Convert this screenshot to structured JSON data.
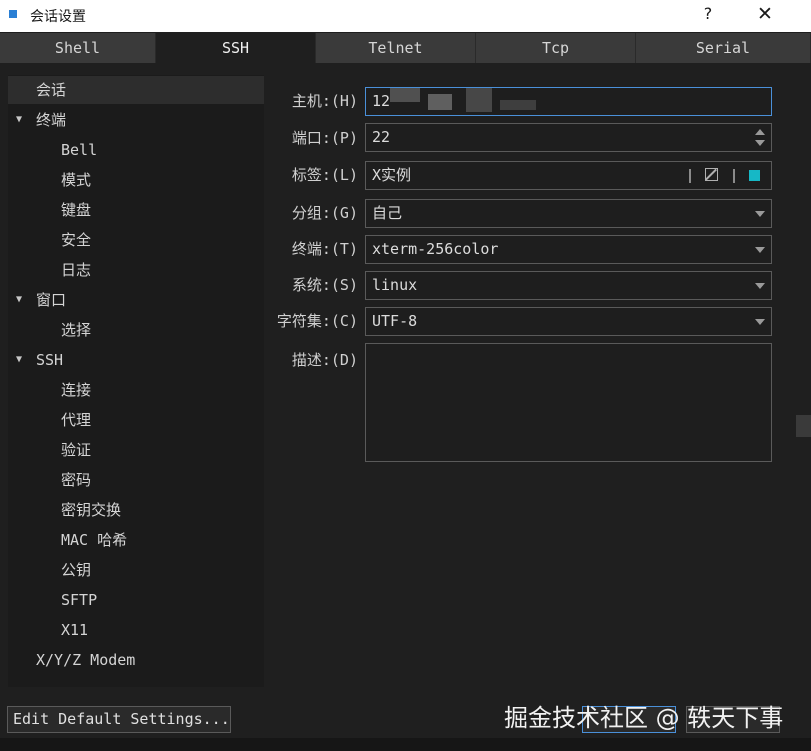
{
  "window": {
    "title": "会话设置",
    "help_label": "?",
    "close_label": "✕"
  },
  "tabs": [
    {
      "label": "Shell",
      "active": false
    },
    {
      "label": "SSH",
      "active": true
    },
    {
      "label": "Telnet",
      "active": false
    },
    {
      "label": "Tcp",
      "active": false
    },
    {
      "label": "Serial",
      "active": false
    }
  ],
  "tree": [
    {
      "label": "会话"
    },
    {
      "label": "终端"
    },
    {
      "label": "Bell"
    },
    {
      "label": "模式"
    },
    {
      "label": "键盘"
    },
    {
      "label": "安全"
    },
    {
      "label": "日志"
    },
    {
      "label": "窗口"
    },
    {
      "label": "选择"
    },
    {
      "label": "SSH"
    },
    {
      "label": "连接"
    },
    {
      "label": "代理"
    },
    {
      "label": "验证"
    },
    {
      "label": "密码"
    },
    {
      "label": "密钥交换"
    },
    {
      "label": "MAC 哈希"
    },
    {
      "label": "公钥"
    },
    {
      "label": "SFTP"
    },
    {
      "label": "X11"
    },
    {
      "label": "X/Y/Z Modem"
    }
  ],
  "form": {
    "host_label": "主机:(H)",
    "host_value": "12",
    "port_label": "端口:(P)",
    "port_value": "22",
    "tag_label": "标签:(L)",
    "tag_value": "X实例",
    "tag_color": "#16b8c6",
    "group_label": "分组:(G)",
    "group_value": "自己",
    "terminal_label": "终端:(T)",
    "terminal_value": "xterm-256color",
    "system_label": "系统:(S)",
    "system_value": "linux",
    "charset_label": "字符集:(C)",
    "charset_value": "UTF-8",
    "desc_label": "描述:(D)",
    "desc_value": ""
  },
  "footer": {
    "edit_default_label": "Edit Default Settings...",
    "watermark": "掘金技术社区 @ 轶天下事"
  },
  "icons": {
    "app": "app-icon",
    "edit": "edit-icon",
    "caret": "caret-down-icon"
  }
}
